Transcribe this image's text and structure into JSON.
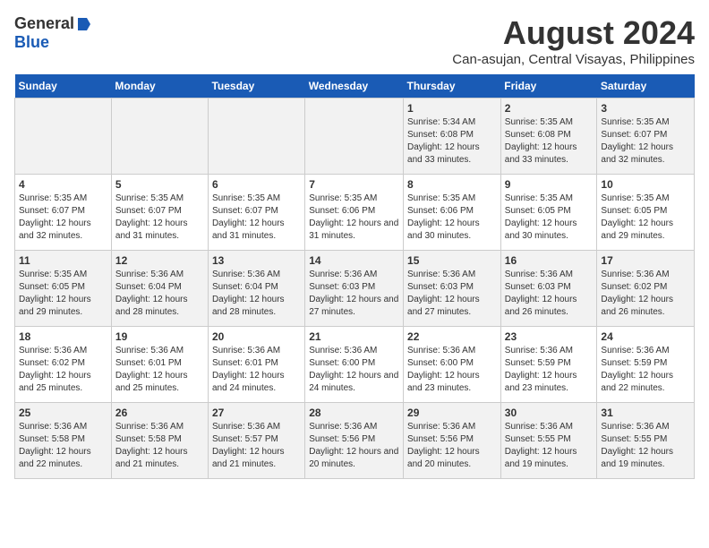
{
  "header": {
    "logo_general": "General",
    "logo_blue": "Blue",
    "month_year": "August 2024",
    "location": "Can-asujan, Central Visayas, Philippines"
  },
  "weekdays": [
    "Sunday",
    "Monday",
    "Tuesday",
    "Wednesday",
    "Thursday",
    "Friday",
    "Saturday"
  ],
  "weeks": [
    [
      {
        "day": "",
        "info": ""
      },
      {
        "day": "",
        "info": ""
      },
      {
        "day": "",
        "info": ""
      },
      {
        "day": "",
        "info": ""
      },
      {
        "day": "1",
        "info": "Sunrise: 5:34 AM\nSunset: 6:08 PM\nDaylight: 12 hours and 33 minutes."
      },
      {
        "day": "2",
        "info": "Sunrise: 5:35 AM\nSunset: 6:08 PM\nDaylight: 12 hours and 33 minutes."
      },
      {
        "day": "3",
        "info": "Sunrise: 5:35 AM\nSunset: 6:07 PM\nDaylight: 12 hours and 32 minutes."
      }
    ],
    [
      {
        "day": "4",
        "info": "Sunrise: 5:35 AM\nSunset: 6:07 PM\nDaylight: 12 hours and 32 minutes."
      },
      {
        "day": "5",
        "info": "Sunrise: 5:35 AM\nSunset: 6:07 PM\nDaylight: 12 hours and 31 minutes."
      },
      {
        "day": "6",
        "info": "Sunrise: 5:35 AM\nSunset: 6:07 PM\nDaylight: 12 hours and 31 minutes."
      },
      {
        "day": "7",
        "info": "Sunrise: 5:35 AM\nSunset: 6:06 PM\nDaylight: 12 hours and 31 minutes."
      },
      {
        "day": "8",
        "info": "Sunrise: 5:35 AM\nSunset: 6:06 PM\nDaylight: 12 hours and 30 minutes."
      },
      {
        "day": "9",
        "info": "Sunrise: 5:35 AM\nSunset: 6:05 PM\nDaylight: 12 hours and 30 minutes."
      },
      {
        "day": "10",
        "info": "Sunrise: 5:35 AM\nSunset: 6:05 PM\nDaylight: 12 hours and 29 minutes."
      }
    ],
    [
      {
        "day": "11",
        "info": "Sunrise: 5:35 AM\nSunset: 6:05 PM\nDaylight: 12 hours and 29 minutes."
      },
      {
        "day": "12",
        "info": "Sunrise: 5:36 AM\nSunset: 6:04 PM\nDaylight: 12 hours and 28 minutes."
      },
      {
        "day": "13",
        "info": "Sunrise: 5:36 AM\nSunset: 6:04 PM\nDaylight: 12 hours and 28 minutes."
      },
      {
        "day": "14",
        "info": "Sunrise: 5:36 AM\nSunset: 6:03 PM\nDaylight: 12 hours and 27 minutes."
      },
      {
        "day": "15",
        "info": "Sunrise: 5:36 AM\nSunset: 6:03 PM\nDaylight: 12 hours and 27 minutes."
      },
      {
        "day": "16",
        "info": "Sunrise: 5:36 AM\nSunset: 6:03 PM\nDaylight: 12 hours and 26 minutes."
      },
      {
        "day": "17",
        "info": "Sunrise: 5:36 AM\nSunset: 6:02 PM\nDaylight: 12 hours and 26 minutes."
      }
    ],
    [
      {
        "day": "18",
        "info": "Sunrise: 5:36 AM\nSunset: 6:02 PM\nDaylight: 12 hours and 25 minutes."
      },
      {
        "day": "19",
        "info": "Sunrise: 5:36 AM\nSunset: 6:01 PM\nDaylight: 12 hours and 25 minutes."
      },
      {
        "day": "20",
        "info": "Sunrise: 5:36 AM\nSunset: 6:01 PM\nDaylight: 12 hours and 24 minutes."
      },
      {
        "day": "21",
        "info": "Sunrise: 5:36 AM\nSunset: 6:00 PM\nDaylight: 12 hours and 24 minutes."
      },
      {
        "day": "22",
        "info": "Sunrise: 5:36 AM\nSunset: 6:00 PM\nDaylight: 12 hours and 23 minutes."
      },
      {
        "day": "23",
        "info": "Sunrise: 5:36 AM\nSunset: 5:59 PM\nDaylight: 12 hours and 23 minutes."
      },
      {
        "day": "24",
        "info": "Sunrise: 5:36 AM\nSunset: 5:59 PM\nDaylight: 12 hours and 22 minutes."
      }
    ],
    [
      {
        "day": "25",
        "info": "Sunrise: 5:36 AM\nSunset: 5:58 PM\nDaylight: 12 hours and 22 minutes."
      },
      {
        "day": "26",
        "info": "Sunrise: 5:36 AM\nSunset: 5:58 PM\nDaylight: 12 hours and 21 minutes."
      },
      {
        "day": "27",
        "info": "Sunrise: 5:36 AM\nSunset: 5:57 PM\nDaylight: 12 hours and 21 minutes."
      },
      {
        "day": "28",
        "info": "Sunrise: 5:36 AM\nSunset: 5:56 PM\nDaylight: 12 hours and 20 minutes."
      },
      {
        "day": "29",
        "info": "Sunrise: 5:36 AM\nSunset: 5:56 PM\nDaylight: 12 hours and 20 minutes."
      },
      {
        "day": "30",
        "info": "Sunrise: 5:36 AM\nSunset: 5:55 PM\nDaylight: 12 hours and 19 minutes."
      },
      {
        "day": "31",
        "info": "Sunrise: 5:36 AM\nSunset: 5:55 PM\nDaylight: 12 hours and 19 minutes."
      }
    ]
  ]
}
